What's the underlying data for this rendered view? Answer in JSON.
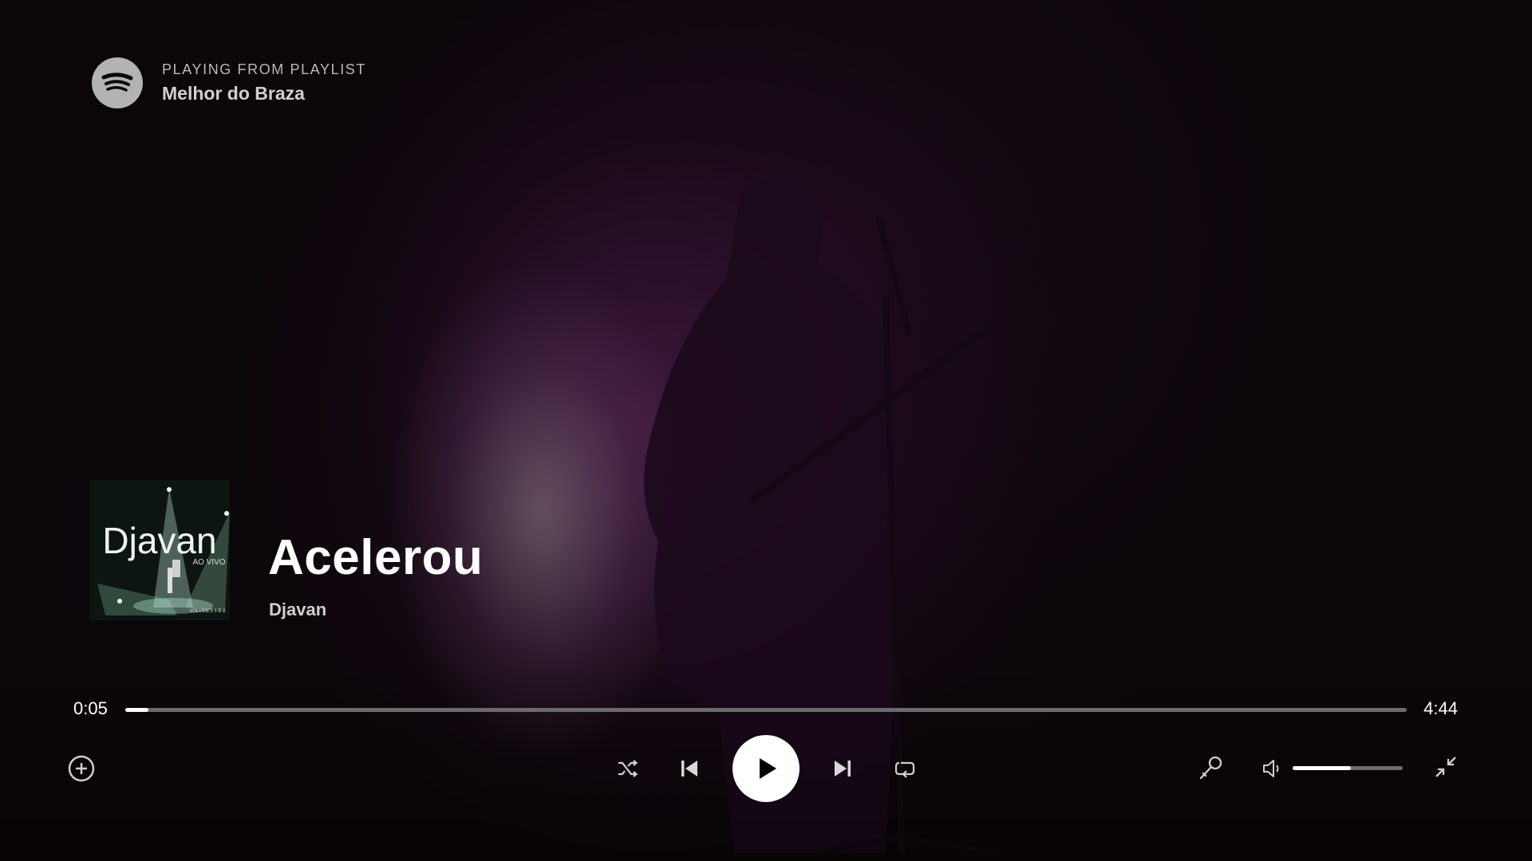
{
  "header": {
    "context_label": "PLAYING FROM PLAYLIST",
    "playlist_name": "Melhor do Braza",
    "logo_icon": "spotify-logo"
  },
  "track": {
    "title": "Acelerou",
    "artist": "Djavan"
  },
  "album_cover": {
    "text_main": "Djavan",
    "text_sub": "AO VIVO",
    "text_vol": "VOLUMES 1 E 2"
  },
  "playback": {
    "elapsed": "0:05",
    "duration": "4:44",
    "progress_fraction": 0.018,
    "volume_fraction": 0.53
  },
  "controls": {
    "add_icon": "plus-circle-icon",
    "shuffle_icon": "shuffle-icon",
    "previous_icon": "skip-previous-icon",
    "play_icon": "play-icon",
    "next_icon": "skip-next-icon",
    "repeat_icon": "repeat-icon",
    "lyrics_icon": "microphone-icon",
    "volume_icon": "volume-icon",
    "minimize_icon": "minimize-icon"
  },
  "colors": {
    "accent": "#ffffff",
    "track_bg": "#6b6b6b",
    "background": "#0b0609"
  }
}
